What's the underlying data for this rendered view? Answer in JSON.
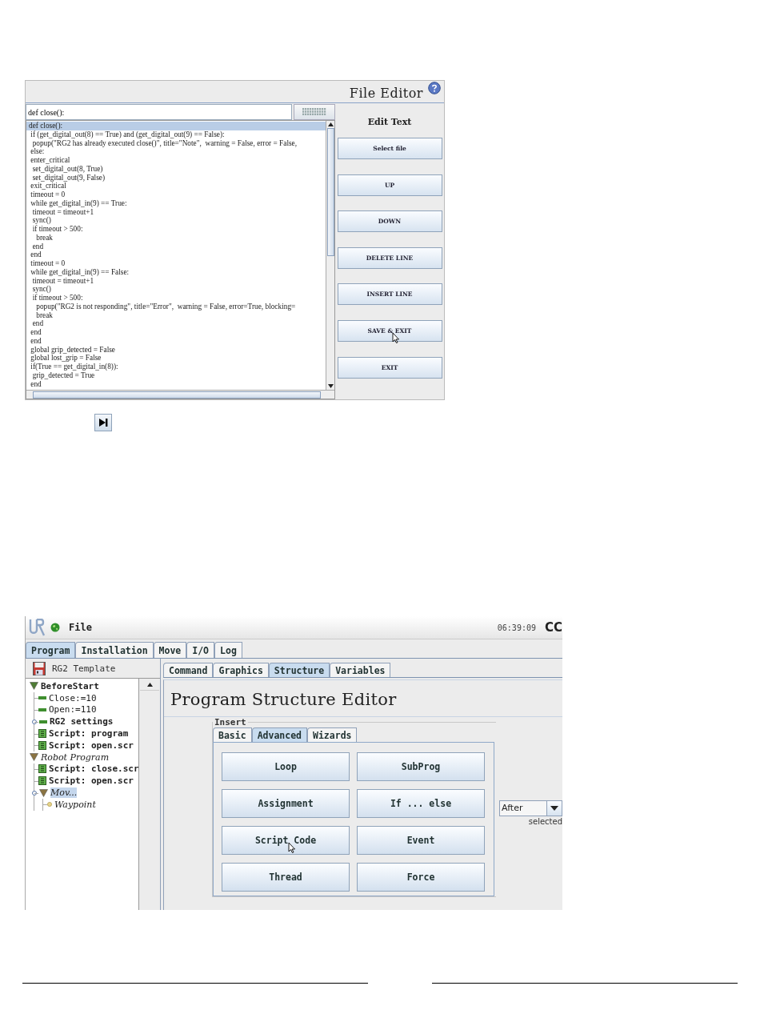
{
  "file_editor": {
    "title": "File Editor",
    "input": {
      "value": "def close():"
    },
    "code_lines": [
      {
        "text": "def close():",
        "selected": true
      },
      {
        "text": " if (get_digital_out(8) == True) and (get_digital_out(9) == False):",
        "selected": false
      },
      {
        "text": "  popup(\"RG2 has already executed close()\", title=\"Note\",  warning = False, error = False,",
        "selected": false
      },
      {
        "text": " else:",
        "selected": false
      },
      {
        "text": " enter_critical",
        "selected": false
      },
      {
        "text": "  set_digital_out(8, True)",
        "selected": false
      },
      {
        "text": "  set_digital_out(9, False)",
        "selected": false
      },
      {
        "text": " exit_critical",
        "selected": false
      },
      {
        "text": " timeout = 0",
        "selected": false
      },
      {
        "text": " while get_digital_in(9) == True:",
        "selected": false
      },
      {
        "text": "  timeout = timeout+1",
        "selected": false
      },
      {
        "text": "  sync()",
        "selected": false
      },
      {
        "text": "  if timeout > 500:",
        "selected": false
      },
      {
        "text": "    break",
        "selected": false
      },
      {
        "text": "  end",
        "selected": false
      },
      {
        "text": " end",
        "selected": false
      },
      {
        "text": " timeout = 0",
        "selected": false
      },
      {
        "text": " while get_digital_in(9) == False:",
        "selected": false
      },
      {
        "text": "  timeout = timeout+1",
        "selected": false
      },
      {
        "text": "  sync()",
        "selected": false
      },
      {
        "text": "  if timeout > 500:",
        "selected": false
      },
      {
        "text": "    popup(\"RG2 is not responding\", title=\"Error\",  warning = False, error=True, blocking=",
        "selected": false
      },
      {
        "text": "    break",
        "selected": false
      },
      {
        "text": "  end",
        "selected": false
      },
      {
        "text": " end",
        "selected": false
      },
      {
        "text": " end",
        "selected": false
      },
      {
        "text": " global grip_detected = False",
        "selected": false
      },
      {
        "text": " global lost_grip = False",
        "selected": false
      },
      {
        "text": " if(True == get_digital_in(8)):",
        "selected": false
      },
      {
        "text": "  grip_detected = True",
        "selected": false
      },
      {
        "text": " end",
        "selected": false
      }
    ],
    "section_title": "Edit Text",
    "buttons": [
      "Select file",
      "UP",
      "DOWN",
      "DELETE LINE",
      "INSERT LINE",
      "SAVE & EXIT",
      "EXIT"
    ]
  },
  "program_window": {
    "menu": "File",
    "time": "06:39:09",
    "status": "CC",
    "tabs": [
      {
        "label": "Program",
        "selected": true
      },
      {
        "label": "Installation",
        "selected": false
      },
      {
        "label": "Move",
        "selected": false
      },
      {
        "label": "I/O",
        "selected": false
      },
      {
        "label": "Log",
        "selected": false
      }
    ],
    "program_name": "RG2 Template",
    "tree": [
      {
        "label": "BeforeStart",
        "kind": "section",
        "expanded": true,
        "selected": false,
        "children": [
          {
            "label": "Close:=10",
            "kind": "assignment",
            "selected": false
          },
          {
            "label": "Open:=110",
            "kind": "assignment",
            "selected": false
          },
          {
            "label": "RG2 settings",
            "kind": "settings",
            "selected": false
          },
          {
            "label": "Script: program",
            "kind": "script",
            "selected": false
          },
          {
            "label": "Script: open.scr",
            "kind": "script",
            "selected": false
          }
        ]
      },
      {
        "label": "Robot Program",
        "kind": "program",
        "expanded": true,
        "selected": false,
        "children": [
          {
            "label": "Script: close.scr",
            "kind": "script",
            "selected": false
          },
          {
            "label": "Script: open.scr",
            "kind": "script",
            "selected": false
          },
          {
            "label": "Mov...",
            "kind": "move",
            "expanded": true,
            "selected": true,
            "children": [
              {
                "label": "Waypoint",
                "kind": "waypoint",
                "selected": false
              }
            ]
          }
        ]
      }
    ],
    "subtabs": [
      {
        "label": "Command",
        "selected": false
      },
      {
        "label": "Graphics",
        "selected": false
      },
      {
        "label": "Structure",
        "selected": true
      },
      {
        "label": "Variables",
        "selected": false
      }
    ],
    "title": "Program Structure Editor",
    "insert": {
      "legend": "Insert",
      "tabs": [
        {
          "label": "Basic",
          "selected": false
        },
        {
          "label": "Advanced",
          "selected": true
        },
        {
          "label": "Wizards",
          "selected": false
        }
      ],
      "buttons": [
        "Loop",
        "SubProg",
        "Assignment",
        "If ... else",
        "Script Code",
        "Event",
        "Thread",
        "Force"
      ]
    },
    "position": {
      "value": "After",
      "label": "selected"
    }
  }
}
